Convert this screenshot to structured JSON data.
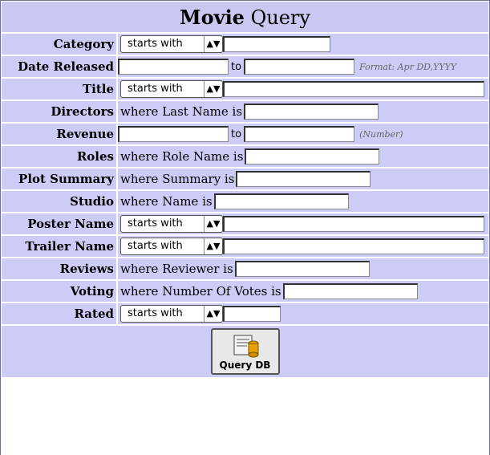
{
  "header": {
    "title_bold": "Movie",
    "title_rest": " Query"
  },
  "select_option": "starts with",
  "rows": {
    "category": {
      "label": "Category"
    },
    "date_released": {
      "label": "Date Released",
      "to": "to",
      "hint": "Format: Apr DD,YYYY"
    },
    "title": {
      "label": "Title"
    },
    "directors": {
      "label": "Directors",
      "prefix": "where Last Name is"
    },
    "revenue": {
      "label": "Revenue",
      "to": "to",
      "hint": "(Number)"
    },
    "roles": {
      "label": "Roles",
      "prefix": "where Role Name is"
    },
    "plot_summary": {
      "label": "Plot Summary",
      "prefix": "where Summary is"
    },
    "studio": {
      "label": "Studio",
      "prefix": "where Name is"
    },
    "poster_name": {
      "label": "Poster Name"
    },
    "trailer_name": {
      "label": "Trailer Name"
    },
    "reviews": {
      "label": "Reviews",
      "prefix": "where Reviewer is"
    },
    "voting": {
      "label": "Voting",
      "prefix": "where Number Of Votes is"
    },
    "rated": {
      "label": "Rated"
    }
  },
  "button": {
    "label": "Query DB",
    "icon": "database-query-icon"
  }
}
